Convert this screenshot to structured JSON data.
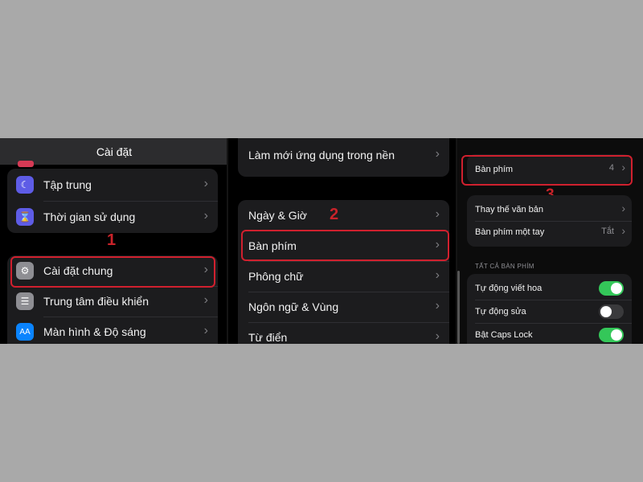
{
  "panel1": {
    "title": "Cài đặt",
    "items": [
      {
        "label": "Tập trung",
        "icon": "moon-icon",
        "color": "#5e5ce6"
      },
      {
        "label": "Thời gian sử dụng",
        "icon": "hourglass-icon",
        "color": "#5e5ce6"
      },
      {
        "label": "Cài đặt chung",
        "icon": "gear-icon",
        "color": "#8e8e93"
      },
      {
        "label": "Trung tâm điều khiển",
        "icon": "toggles-icon",
        "color": "#8e8e93"
      },
      {
        "label": "Màn hình & Độ sáng",
        "icon": "aa-icon",
        "color": "#0a84ff",
        "icon_text": "AA"
      }
    ],
    "step": "1"
  },
  "panel2": {
    "items": [
      {
        "label": "Làm mới ứng dụng trong nền"
      },
      {
        "label": "Ngày & Giờ"
      },
      {
        "label": "Bàn phím"
      },
      {
        "label": "Phông chữ"
      },
      {
        "label": "Ngôn ngữ & Vùng"
      },
      {
        "label": "Từ điển"
      }
    ],
    "step": "2"
  },
  "panel3": {
    "keyboards": {
      "label": "Bàn phím",
      "value": "4"
    },
    "step": "3",
    "text_replacement": "Thay thế văn bản",
    "one_handed": {
      "label": "Bàn phím một tay",
      "value": "Tắt"
    },
    "section_header": "TẤT CẢ BÀN PHÍM",
    "toggles": [
      {
        "label": "Tự động viết hoa",
        "on": true
      },
      {
        "label": "Tự động sửa",
        "on": false
      },
      {
        "label": "Bật Caps Lock",
        "on": true
      }
    ]
  },
  "colors": {
    "highlight": "#d0202e",
    "toggle_on": "#34c759",
    "toggle_off": "#3a3a3c"
  }
}
